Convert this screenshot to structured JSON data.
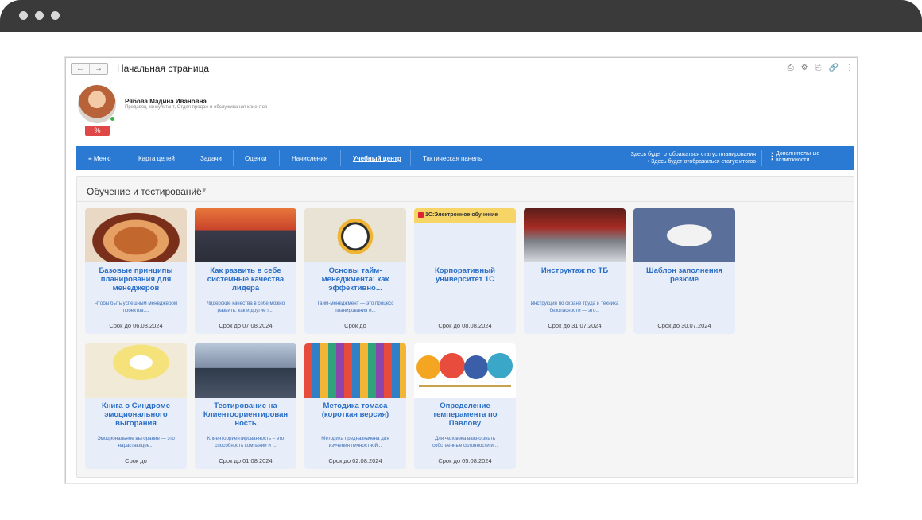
{
  "window": {
    "title": "Начальная страница",
    "nav_back": "←",
    "nav_forward": "→",
    "tool_icons": [
      "⎙",
      "⚙",
      "⎘",
      "🔗",
      "⋮"
    ]
  },
  "profile": {
    "name": "Рябова Мадина Ивановна",
    "role": "Продавец-консультант, Отдел продаж и обслуживания клиентов",
    "percent": "%"
  },
  "nav": {
    "menu": "≡ Меню",
    "items": [
      "Карта целей",
      "Задачи",
      "Оценки",
      "Начисления",
      "Учебный центр",
      "Тактическая панель"
    ],
    "status_planning": "Здесь будет отображаться статус планирования",
    "status_results": "• Здесь будет отображаться статус итогов",
    "more_line1": "Дополнительные",
    "more_line2": "возможности"
  },
  "section": {
    "title": "Обучение и тестирование",
    "filter_icons": "M ▼"
  },
  "cards": [
    {
      "title": "Базовые принципы планирования для менеджеров",
      "desc": "Чтобы быть успешным менеджером проектов,...",
      "due": "Срок до 06.08.2024"
    },
    {
      "title": "Как развить в себе системные качества лидера",
      "desc": "Лидерские качества в себе можно развить, как и другие s...",
      "due": "Срок до 07.08.2024"
    },
    {
      "title": "Основы тайм-менеджмента: как эффективно...",
      "desc": "Тайм-менеджмент — это процесс планирования и...",
      "due": "Срок до"
    },
    {
      "title": "Корпоративный университет 1С",
      "badge": "1С:Электронное обучение",
      "desc": "",
      "due": "Срок до 08.08.2024"
    },
    {
      "title": "Инструктаж по ТБ",
      "desc": "Инструкция по охране труда и техника безопасности — это...",
      "due": "Срок до 31.07.2024"
    },
    {
      "title": "Шаблон заполнения резюме",
      "desc": "",
      "due": "Срок до 30.07.2024"
    },
    {
      "title": "Книга о Синдроме эмоционального выгорания",
      "desc": "Эмоциональное выгорание — это нарастающее...",
      "due": "Срок до"
    },
    {
      "title": "Тестирование на Клиентоориентирован ность",
      "desc": "Клиентоориентированность – это способность компании и ...",
      "due": "Срок до 01.08.2024"
    },
    {
      "title": "Методика томаса (короткая версия)",
      "desc": "Методика предназначена для изучения личностной...",
      "due": "Срок до 02.08.2024"
    },
    {
      "title": "Определение темперамента по Павлову",
      "desc": "Для человека важно знать собственные склонности и...",
      "due": "Срок до 05.08.2024"
    }
  ]
}
